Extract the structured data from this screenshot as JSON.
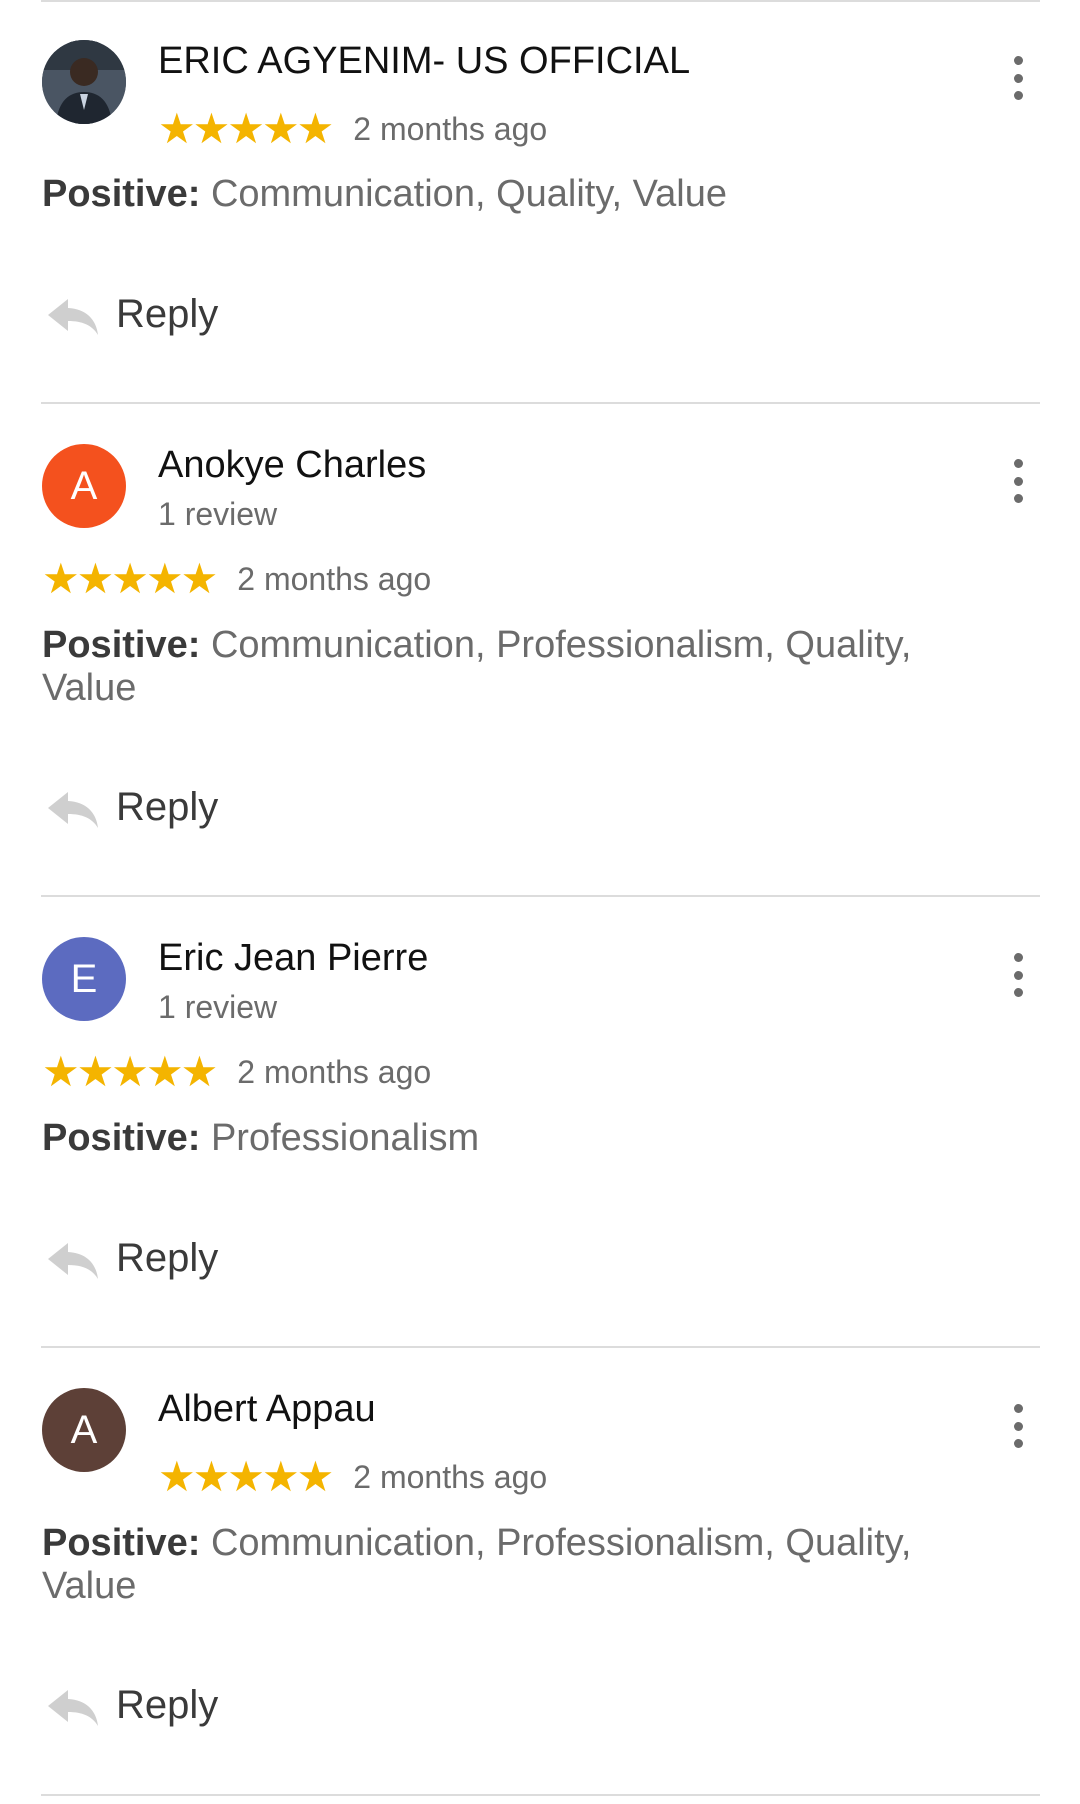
{
  "reviews": [
    {
      "author": "ERIC AGYENIM- US OFFICIAL",
      "avatar": {
        "type": "photo",
        "icon": "user-photo"
      },
      "review_count": "",
      "stars": "★★★★★",
      "rating": 5,
      "time": "2 months ago",
      "positive_label": "Positive:",
      "positive_text": "Communication, Quality, Value",
      "reply_label": "Reply"
    },
    {
      "author": "Anokye Charles",
      "avatar": {
        "type": "letter",
        "letter": "A",
        "color": "#f4511e"
      },
      "review_count": "1 review",
      "stars": "★★★★★",
      "rating": 5,
      "time": "2 months ago",
      "positive_label": "Positive:",
      "positive_text": "Communication, Professionalism, Quality, Value",
      "reply_label": "Reply"
    },
    {
      "author": "Eric Jean Pierre",
      "avatar": {
        "type": "letter",
        "letter": "E",
        "color": "#5c6bc0"
      },
      "review_count": "1 review",
      "stars": "★★★★★",
      "rating": 5,
      "time": "2 months ago",
      "positive_label": "Positive:",
      "positive_text": "Professionalism",
      "reply_label": "Reply"
    },
    {
      "author": "Albert Appau",
      "avatar": {
        "type": "letter",
        "letter": "A",
        "color": "#5d4037"
      },
      "review_count": "",
      "stars": "★★★★★",
      "rating": 5,
      "time": "2 months ago",
      "positive_label": "Positive:",
      "positive_text": "Communication, Professionalism, Quality, Value",
      "reply_label": "Reply"
    }
  ],
  "colors": {
    "star": "#f4b400",
    "text_primary": "#111111",
    "text_secondary": "#6b6b6b",
    "divider": "#dcdcdc"
  },
  "icons": {
    "reply": "reply-arrow-icon",
    "more": "more-vertical-icon"
  }
}
